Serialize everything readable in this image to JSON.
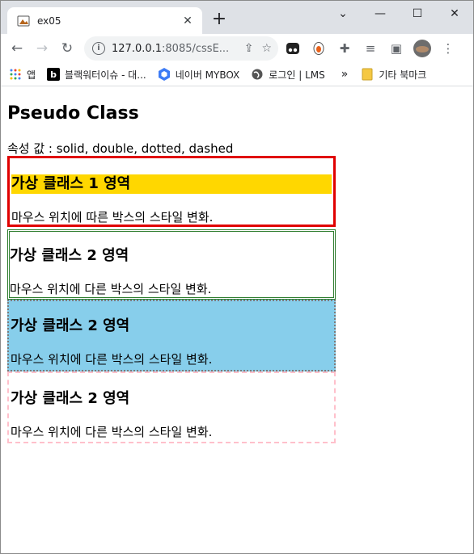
{
  "browser": {
    "tab_title": "ex05",
    "tab_close": "✕",
    "new_tab": "+",
    "window_controls": {
      "minimize": "—",
      "maximize": "☐",
      "close": "✕",
      "dropdown": "⌄"
    },
    "url_host": "127.0.0.1",
    "url_rest": ":8085/cssE...",
    "nav": {
      "back": "←",
      "forward": "→",
      "reload": "↻"
    },
    "bookmarks": [
      {
        "icon": "apps-icon",
        "label": "앱"
      },
      {
        "icon": "b-logo-icon",
        "label": "블랙워터이슈 - 대..."
      },
      {
        "icon": "cube-icon",
        "label": "네이버 MYBOX"
      },
      {
        "icon": "globe-icon",
        "label": "로그인 | LMS"
      }
    ],
    "bookmarks_overflow": "»",
    "other_bookmarks": "기타 북마크"
  },
  "page": {
    "title": "Pseudo Class",
    "attr_line": "속성 값 : solid, double, dotted, dashed",
    "boxes": [
      {
        "heading": "가상 클래스 1 영역",
        "text": "마우스 위치에 따른 박스의 스타일 변화."
      },
      {
        "heading": "가상 클래스 2 영역",
        "text": "마우스 위치에 다른 박스의 스타일 변화."
      },
      {
        "heading": "가상 클래스 2 영역",
        "text": "마우스 위치에 다른 박스의 스타일 변화."
      },
      {
        "heading": "가상 클래스 2 영역",
        "text": "마우스 위치에 다른 박스의 스타일 변화."
      }
    ]
  },
  "colors": {
    "box1_border": "#e00000",
    "box1_heading_bg": "#ffd700",
    "box2_border": "#2e7d2e",
    "box3_bg": "#87ceeb",
    "box3_border": "#7a7a7a",
    "box4_border": "#ffc0cb"
  }
}
